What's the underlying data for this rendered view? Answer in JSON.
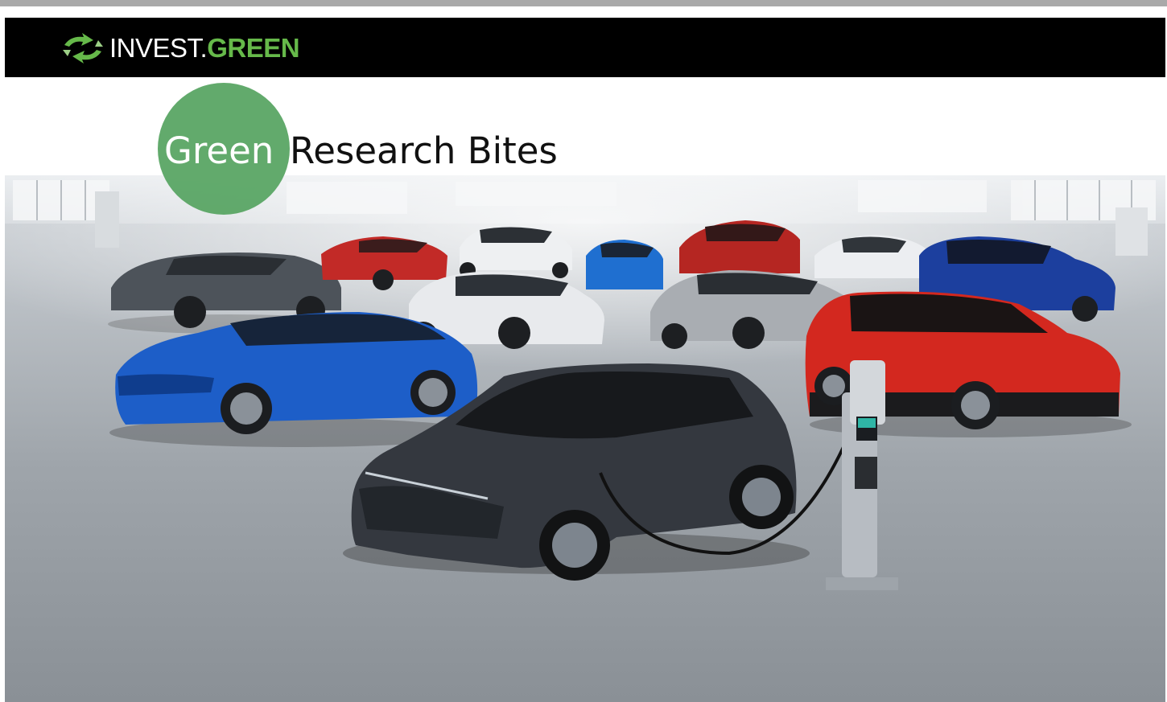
{
  "brand": {
    "logo_invest": "INVEST.",
    "logo_green": "GREEN",
    "logo_icon": "recycle-arrows-icon",
    "accent_color": "#66b94a"
  },
  "banner": {
    "title_highlight": "Green",
    "title_rest": "Research Bites",
    "circle_color": "#5aa564"
  },
  "hero_image": {
    "subject": "lineup of electric and hybrid cars in a showroom with a charging station",
    "icons": [
      "car-icon",
      "charging-station-icon"
    ]
  }
}
